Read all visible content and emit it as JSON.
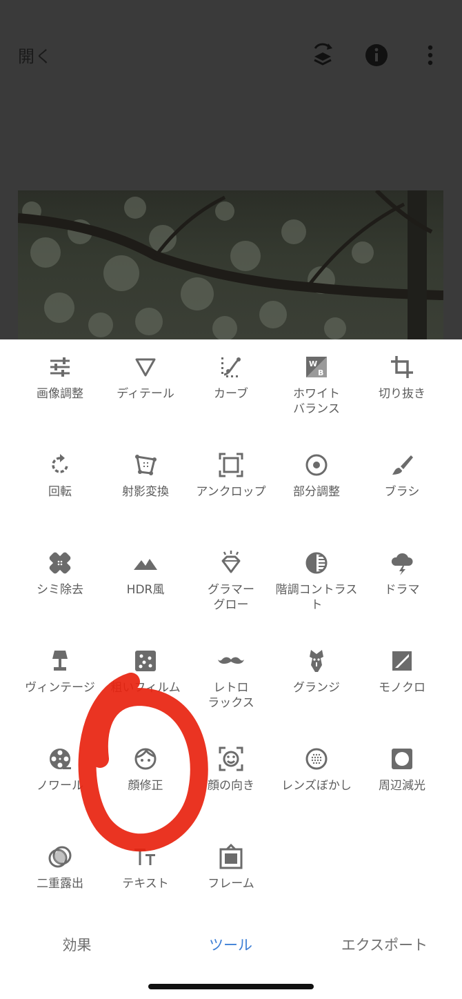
{
  "header": {
    "open_label": "開く",
    "icons": [
      "layers-icon",
      "info-icon",
      "more-vertical-icon"
    ]
  },
  "tools": [
    {
      "label": "画像調整",
      "icon": "tune-icon"
    },
    {
      "label": "ディテール",
      "icon": "details-triangle-icon"
    },
    {
      "label": "カーブ",
      "icon": "curves-icon"
    },
    {
      "label": "ホワイト\nバランス",
      "icon": "white-balance-icon"
    },
    {
      "label": "切り抜き",
      "icon": "crop-icon"
    },
    {
      "label": "回転",
      "icon": "rotate-icon"
    },
    {
      "label": "射影変換",
      "icon": "perspective-icon"
    },
    {
      "label": "アンクロップ",
      "icon": "expand-icon"
    },
    {
      "label": "部分調整",
      "icon": "selective-icon"
    },
    {
      "label": "ブラシ",
      "icon": "brush-icon"
    },
    {
      "label": "シミ除去",
      "icon": "healing-icon"
    },
    {
      "label": "HDR風",
      "icon": "hdr-mountain-icon"
    },
    {
      "label": "グラマー\nグロー",
      "icon": "glamour-glow-icon"
    },
    {
      "label": "階調コントラスト",
      "icon": "tonal-contrast-icon"
    },
    {
      "label": "ドラマ",
      "icon": "drama-cloud-icon"
    },
    {
      "label": "ヴィンテージ",
      "icon": "vintage-lamp-icon"
    },
    {
      "label": "粗いフィルム",
      "icon": "grainy-film-icon"
    },
    {
      "label": "レトロ\nラックス",
      "icon": "mustache-icon"
    },
    {
      "label": "グランジ",
      "icon": "grunge-icon"
    },
    {
      "label": "モノクロ",
      "icon": "black-white-icon"
    },
    {
      "label": "ノワール",
      "icon": "film-reel-icon"
    },
    {
      "label": "顔修正",
      "icon": "face-icon"
    },
    {
      "label": "顔の向き",
      "icon": "face-pose-icon"
    },
    {
      "label": "レンズぼかし",
      "icon": "lens-blur-icon"
    },
    {
      "label": "周辺減光",
      "icon": "vignette-icon"
    },
    {
      "label": "二重露出",
      "icon": "double-exposure-icon"
    },
    {
      "label": "テキスト",
      "icon": "text-icon"
    },
    {
      "label": "フレーム",
      "icon": "frame-icon"
    }
  ],
  "tabs": [
    {
      "label": "効果",
      "active": false
    },
    {
      "label": "ツール",
      "active": true
    },
    {
      "label": "エクスポート",
      "active": false
    }
  ],
  "colors": {
    "icon": "#6b6b6b",
    "label": "#5c5c5c",
    "active_tab": "#3d7fd6",
    "annotation": "#e8230f"
  }
}
